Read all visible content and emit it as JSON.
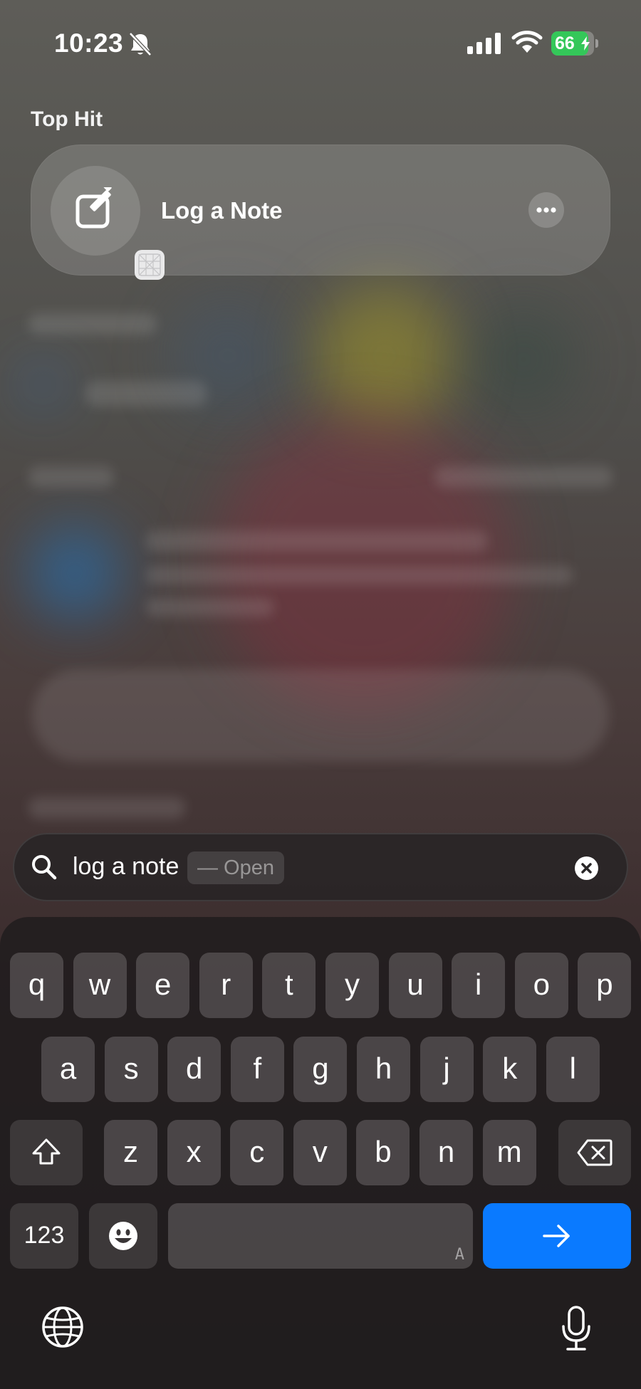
{
  "status_bar": {
    "time": "10:23",
    "battery_percent": "66",
    "icons": [
      "bell-slash-icon",
      "cellular-signal-icon",
      "wifi-icon",
      "battery-charging-icon"
    ]
  },
  "top_hit": {
    "section_label": "Top Hit",
    "title": "Log a Note",
    "icons": [
      "compose-note-icon",
      "shortcut-badge-icon",
      "more-icon"
    ]
  },
  "search": {
    "query": "log a note",
    "suggestion": "— Open",
    "icons": [
      "search-icon",
      "clear-icon"
    ]
  },
  "keyboard": {
    "row1": [
      "q",
      "w",
      "e",
      "r",
      "t",
      "y",
      "u",
      "i",
      "o",
      "p"
    ],
    "row2": [
      "a",
      "s",
      "d",
      "f",
      "g",
      "h",
      "j",
      "k",
      "l"
    ],
    "row3": [
      "z",
      "x",
      "c",
      "v",
      "b",
      "n",
      "m"
    ],
    "numbers_label": "123",
    "space_hint": "A",
    "icons": [
      "shift-icon",
      "delete-icon",
      "emoji-icon",
      "go-arrow-icon",
      "globe-icon",
      "microphone-icon"
    ]
  },
  "colors": {
    "go_key": "#0a7aff",
    "battery": "#34c759"
  }
}
